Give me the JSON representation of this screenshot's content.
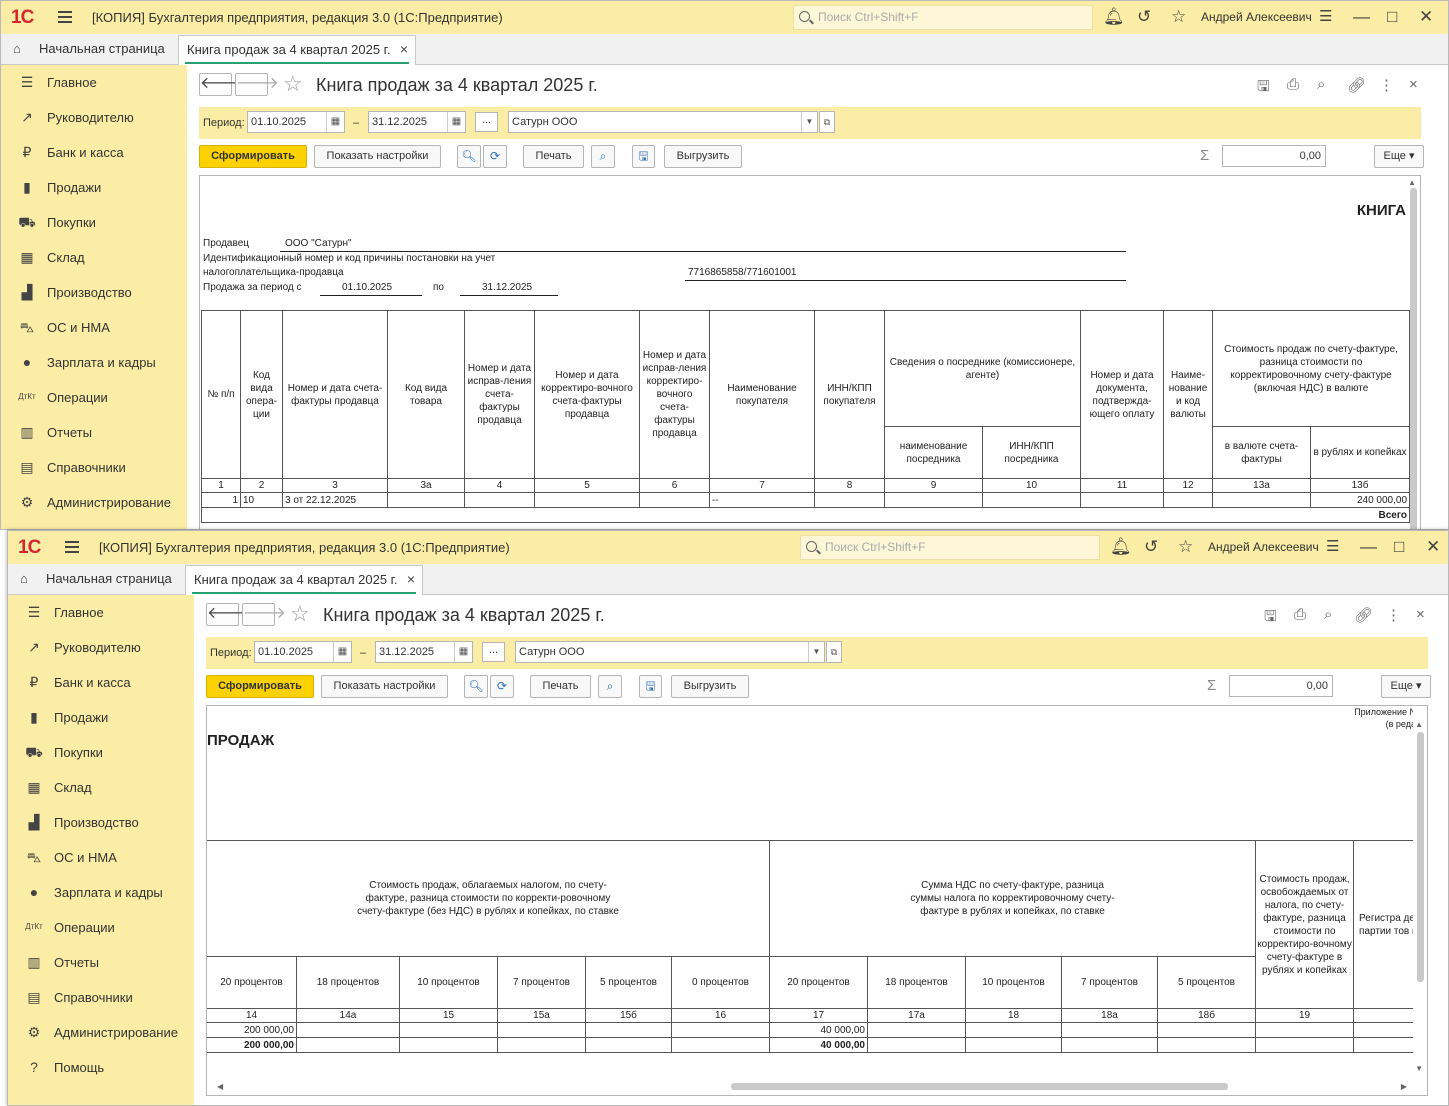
{
  "app": {
    "logo": "1С",
    "title": "[КОПИЯ] Бухгалтерия предприятия, редакция 3.0  (1С:Предприятие)",
    "search_placeholder": "Поиск Ctrl+Shift+F",
    "user": "Андрей Алексеевич",
    "home_tab": "Начальная страница",
    "doc_tab": "Книга продаж за 4 квартал 2025 г.",
    "close_glyph": "×",
    "minimize_glyph": "—",
    "maximize_glyph": "□",
    "close_window_glyph": "✕"
  },
  "sidebar": {
    "items": [
      {
        "label": "Главное",
        "icon": "☰"
      },
      {
        "label": "Руководителю",
        "icon": "↗"
      },
      {
        "label": "Банк и касса",
        "icon": "₽"
      },
      {
        "label": "Продажи",
        "icon": "▮"
      },
      {
        "label": "Покупки",
        "icon": "⛟"
      },
      {
        "label": "Склад",
        "icon": "▦"
      },
      {
        "label": "Производство",
        "icon": "▟"
      },
      {
        "label": "ОС и НМА",
        "icon": "⛍"
      },
      {
        "label": "Зарплата и кадры",
        "icon": "●"
      },
      {
        "label": "Операции",
        "icon": "ДтКт"
      },
      {
        "label": "Отчеты",
        "icon": "▥"
      },
      {
        "label": "Справочники",
        "icon": "▤"
      },
      {
        "label": "Администрирование",
        "icon": "⚙"
      },
      {
        "label": "Помощь",
        "icon": "?"
      }
    ]
  },
  "report": {
    "title": "Книга продаж за 4 квартал 2025 г.",
    "period_label": "Период:",
    "date_from": "01.10.2025",
    "dash": "–",
    "date_to": "31.12.2025",
    "dots": "...",
    "org": "Сатурн ООО",
    "btn_generate": "Сформировать",
    "btn_settings": "Показать настройки",
    "btn_print": "Печать",
    "btn_export": "Выгрузить",
    "sum_value": "0,00",
    "btn_more": "Еще",
    "sigma": "Σ"
  },
  "sheet1": {
    "header_kniga": "КНИГА",
    "seller_label": "Продавец",
    "seller_value": "ООО \"Сатурн\"",
    "inn_label_1": "Идентификационный номер и код причины постановки на учет",
    "inn_label_2": "налогоплательщика-продавца",
    "inn_value": "7716865858/771601001",
    "period_label": "Продажа за период с",
    "period_from": "01.10.2025",
    "period_to_label": "по",
    "period_to": "31.12.2025",
    "headers": [
      "№ п/п",
      "Код вида опера-ции",
      "Номер и дата счета-фактуры продавца",
      "Код вида товара",
      "Номер и дата исправ-ления счета-фактуры продавца",
      "Номер и дата корректиро-вочного счета-фактуры продавца",
      "Номер и дата исправ-ления корректиро-вочного счета-фактуры продавца",
      "Наименование покупателя",
      "ИНН/КПП покупателя",
      "Сведения о посреднике (комиссионере, агенте)",
      "Номер и дата документа, подтвержда-ющего оплату",
      "Наиме-нование и код валюты",
      "Стоимость продаж по счету-фактуре, разница стоимости по корректировочному счету-фактуре (включая НДС) в валюте"
    ],
    "subheaders": [
      "наименование посредника",
      "ИНН/КПП посредника",
      "в валюте счета-фактуры",
      "в рублях и копейках"
    ],
    "colnums": [
      "1",
      "2",
      "3",
      "3а",
      "4",
      "5",
      "6",
      "7",
      "8",
      "9",
      "10",
      "11",
      "12",
      "13а",
      "13б"
    ],
    "row": [
      "1",
      "10",
      "3 от 22.12.2025",
      "",
      "",
      "",
      "",
      "--",
      "",
      "",
      "",
      "",
      "",
      "",
      "240 000,00"
    ],
    "total_label": "Всего"
  },
  "sheet2": {
    "appendix_1": "Приложение N",
    "appendix_2": "(в реда",
    "header_prodazh": "ПРОДАЖ",
    "group1": "Стоимость продаж, облагаемых налогом, по счету-фактуре, разница стоимости по корректи-ровочному счету-фактуре (без НДС) в рублях и копейках, по ставке",
    "group2": "Сумма НДС по счету-фактуре, разница суммы налога по корректировочному счету-фактуре в рублях и копейках, по ставке",
    "group3": "Стоимость продаж, освобождаемых от налога, по счету-фактуре, разница стоимости по корректиро-вочному счету-фактуре в рублях и копейках",
    "group4": "Регистра деклара или регист партии тов просл",
    "rates": [
      "20 процентов",
      "18 процентов",
      "10 процентов",
      "7 процентов",
      "5 процентов",
      "0 процентов",
      "20 процентов",
      "18 процентов",
      "10 процентов",
      "7 процентов",
      "5 процентов"
    ],
    "colnums": [
      "14",
      "14а",
      "15",
      "15а",
      "15б",
      "16",
      "17",
      "17а",
      "18",
      "18а",
      "18б",
      "19",
      ""
    ],
    "row": [
      "200 000,00",
      "",
      "",
      "",
      "",
      "",
      "40 000,00",
      "",
      "",
      "",
      "",
      "",
      ""
    ],
    "total": [
      "200 000,00",
      "",
      "",
      "",
      "",
      "",
      "40 000,00",
      "",
      "",
      "",
      "",
      "",
      ""
    ]
  }
}
